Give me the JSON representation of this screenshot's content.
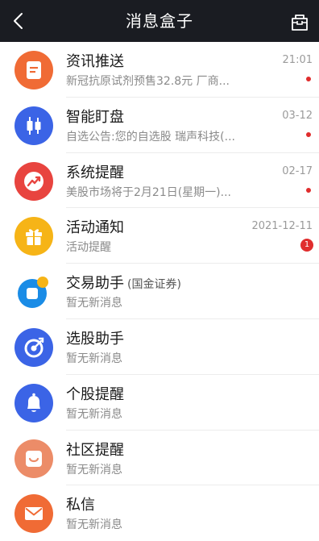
{
  "header": {
    "title": "消息盒子"
  },
  "colors": {
    "header_bg": "#1a1c22",
    "orange": "#f06b35",
    "blue": "#3b64e6",
    "red": "#e8443f",
    "yellow": "#f6b417",
    "unread": "#e02d2d"
  },
  "items": [
    {
      "name": "资讯推送",
      "preview": "新冠抗原试剂预售32.8元 厂商...",
      "time": "21:01",
      "unread_dot": true,
      "icon": "news-doc-icon",
      "color": "#f06b35"
    },
    {
      "name": "智能盯盘",
      "preview": "自选公告:您的自选股 瑞声科技(...",
      "time": "03-12",
      "unread_dot": true,
      "icon": "candlestick-icon",
      "color": "#3b64e6"
    },
    {
      "name": "系统提醒",
      "preview": "美股市场将于2月21日(星期一)...",
      "time": "02-17",
      "unread_dot": true,
      "icon": "trend-up-icon",
      "color": "#e8443f"
    },
    {
      "name": "活动通知",
      "preview": "活动提醒",
      "time": "2021-12-11",
      "badge": "1",
      "icon": "gift-icon",
      "color": "#f6b417"
    },
    {
      "name": "交易助手",
      "name_sub": "(国金证券)",
      "preview": "暂无新消息",
      "icon": "broker-logo-icon",
      "color": "#1a8ce6"
    },
    {
      "name": "选股助手",
      "preview": "暂无新消息",
      "icon": "target-icon",
      "color": "#3b64e6"
    },
    {
      "name": "个股提醒",
      "preview": "暂无新消息",
      "icon": "bell-icon",
      "color": "#3b64e6"
    },
    {
      "name": "社区提醒",
      "preview": "暂无新消息",
      "icon": "smile-bag-icon",
      "color": "#ec8c68"
    },
    {
      "name": "私信",
      "preview": "暂无新消息",
      "icon": "mail-icon",
      "color": "#f06b35"
    }
  ]
}
